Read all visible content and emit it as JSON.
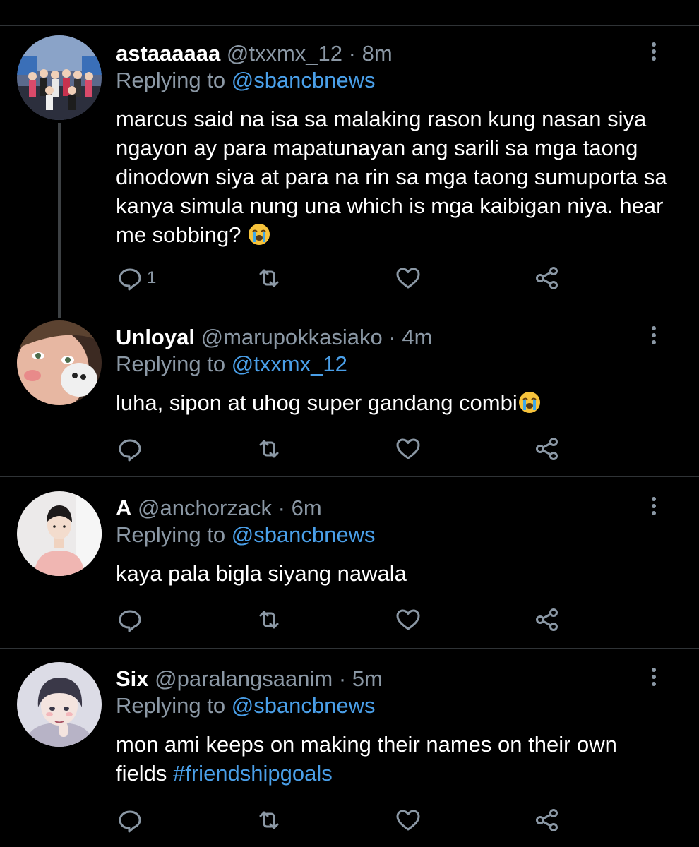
{
  "tweets": [
    {
      "name": "astaaaaaa",
      "handle": "@txxmx_12",
      "separator": "·",
      "time": "8m",
      "reply_prefix": "Replying to",
      "reply_to": "@sbancbnews",
      "body": "marcus said na isa sa malaking rason kung nasan siya ngayon ay para mapatunayan ang sarili sa mga taong dinodown siya at para na rin sa mga taong sumuporta sa kanya simula nung una which is mga kaibigan niya. hear me sobbing?",
      "emoji": "loudly-crying-face",
      "reply_count": "1"
    },
    {
      "name": "Unloyal",
      "handle": "@marupokkasiako",
      "separator": "·",
      "time": "4m",
      "reply_prefix": "Replying to",
      "reply_to": "@txxmx_12",
      "body": "luha, sipon at uhog super gandang combi",
      "emoji": "loudly-crying-face",
      "reply_count": ""
    },
    {
      "name": "A",
      "handle": "@anchorzack",
      "separator": "·",
      "time": "6m",
      "reply_prefix": "Replying to",
      "reply_to": "@sbancbnews",
      "body": "kaya pala bigla siyang nawala",
      "reply_count": ""
    },
    {
      "name": "Six",
      "handle": "@paralangsaanim",
      "separator": "·",
      "time": "5m",
      "reply_prefix": "Replying to",
      "reply_to": "@sbancbnews",
      "body": "mon ami keeps on making their names on their own fields",
      "hashtag": "#friendshipgoals",
      "reply_count": ""
    }
  ],
  "icons": {
    "reply": "reply-icon",
    "retweet": "retweet-icon",
    "like": "like-icon",
    "share": "share-icon",
    "more": "more-options-icon"
  },
  "colors": {
    "background": "#000000",
    "text": "#ffffff",
    "secondary": "#8b98a5",
    "link": "#4a9fe8",
    "divider": "#2f3336"
  }
}
